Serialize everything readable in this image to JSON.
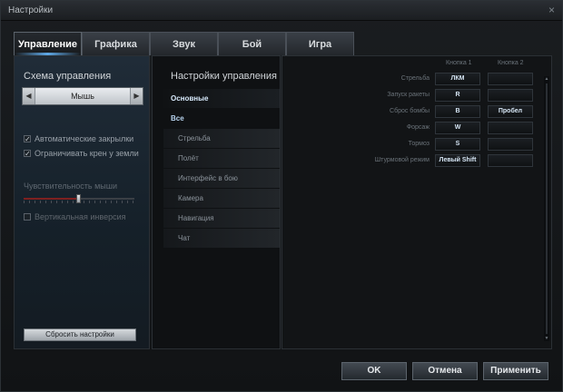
{
  "window": {
    "title": "Настройки",
    "close_glyph": "×"
  },
  "tabs": [
    {
      "label": "Управление",
      "active": true
    },
    {
      "label": "Графика",
      "active": false
    },
    {
      "label": "Звук",
      "active": false
    },
    {
      "label": "Бой",
      "active": false
    },
    {
      "label": "Игра",
      "active": false
    }
  ],
  "left": {
    "scheme_title": "Схема управления",
    "scheme_value": "Мышь",
    "auto_flaps": {
      "label": "Автоматические закрылки",
      "checked": true
    },
    "limit_bank": {
      "label": "Ограничивать крен у земли",
      "checked": true
    },
    "sensitivity_label": "Чувствительность мыши",
    "sensitivity_value": 0.5,
    "invert": {
      "label": "Вертикальная инверсия",
      "checked": false
    },
    "reset_label": "Сбросить настройки"
  },
  "middle": {
    "title": "Настройки управления",
    "items": [
      {
        "label": "Основные",
        "kind": "selected"
      },
      {
        "label": "Все",
        "kind": "group"
      },
      {
        "label": "Стрельба",
        "kind": "sub"
      },
      {
        "label": "Полёт",
        "kind": "sub"
      },
      {
        "label": "Интерфейс в бою",
        "kind": "sub"
      },
      {
        "label": "Камера",
        "kind": "sub"
      },
      {
        "label": "Навигация",
        "kind": "sub"
      },
      {
        "label": "Чат",
        "kind": "sub"
      }
    ]
  },
  "right": {
    "col1": "Кнопка 1",
    "col2": "Кнопка 2",
    "rows": [
      {
        "label": "Стрельба",
        "key1": "ЛКМ",
        "key2": ""
      },
      {
        "label": "Запуск ракеты",
        "key1": "R",
        "key2": ""
      },
      {
        "label": "Сброс бомбы",
        "key1": "B",
        "key2": "Пробел"
      },
      {
        "label": "Форсаж",
        "key1": "W",
        "key2": ""
      },
      {
        "label": "Тормоз",
        "key1": "S",
        "key2": ""
      },
      {
        "label": "Штурмовой режим",
        "key1": "Левый Shift",
        "key2": ""
      }
    ]
  },
  "buttons": {
    "ok": "OK",
    "cancel": "Отмена",
    "apply": "Применить"
  }
}
